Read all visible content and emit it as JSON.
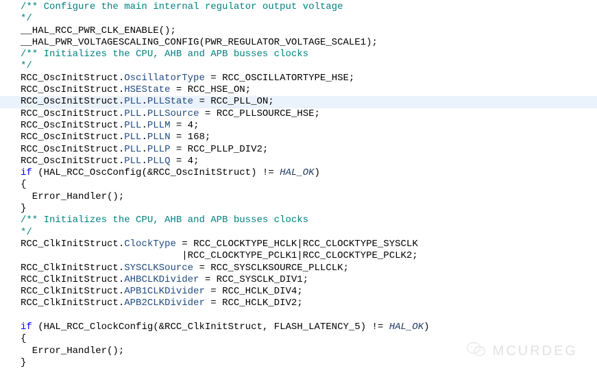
{
  "code": {
    "lines": [
      {
        "hl": false,
        "tokens": [
          {
            "cls": "c-comment",
            "t": "/** Configure the main internal regulator output voltage "
          }
        ]
      },
      {
        "hl": false,
        "tokens": [
          {
            "cls": "c-comment",
            "t": "*/"
          }
        ]
      },
      {
        "hl": false,
        "tokens": [
          {
            "cls": "c-default",
            "t": "__HAL_RCC_PWR_CLK_ENABLE();"
          }
        ]
      },
      {
        "hl": false,
        "tokens": [
          {
            "cls": "c-default",
            "t": "__HAL_PWR_VOLTAGESCALING_CONFIG(PWR_REGULATOR_VOLTAGE_SCALE1);"
          }
        ]
      },
      {
        "hl": false,
        "tokens": [
          {
            "cls": "c-comment",
            "t": "/** Initializes the CPU, AHB and APB busses clocks "
          }
        ]
      },
      {
        "hl": false,
        "tokens": [
          {
            "cls": "c-comment",
            "t": "*/"
          }
        ]
      },
      {
        "hl": false,
        "tokens": [
          {
            "cls": "c-default",
            "t": "RCC_OscInitStruct."
          },
          {
            "cls": "c-field",
            "t": "OscillatorType"
          },
          {
            "cls": "c-default",
            "t": " = RCC_OSCILLATORTYPE_HSE;"
          }
        ]
      },
      {
        "hl": false,
        "tokens": [
          {
            "cls": "c-default",
            "t": "RCC_OscInitStruct."
          },
          {
            "cls": "c-field",
            "t": "HSEState"
          },
          {
            "cls": "c-default",
            "t": " = RCC_HSE_ON;"
          }
        ]
      },
      {
        "hl": true,
        "tokens": [
          {
            "cls": "c-default",
            "t": "RCC_OscInitStruct."
          },
          {
            "cls": "c-field",
            "t": "PLL"
          },
          {
            "cls": "c-default",
            "t": "."
          },
          {
            "cls": "c-field",
            "t": "PLLState"
          },
          {
            "cls": "c-default",
            "t": " = RCC_PLL_ON;"
          }
        ]
      },
      {
        "hl": false,
        "tokens": [
          {
            "cls": "c-default",
            "t": "RCC_OscInitStruct."
          },
          {
            "cls": "c-field",
            "t": "PLL"
          },
          {
            "cls": "c-default",
            "t": "."
          },
          {
            "cls": "c-field",
            "t": "PLLSource"
          },
          {
            "cls": "c-default",
            "t": " = RCC_PLLSOURCE_HSE;"
          }
        ]
      },
      {
        "hl": false,
        "tokens": [
          {
            "cls": "c-default",
            "t": "RCC_OscInitStruct."
          },
          {
            "cls": "c-field",
            "t": "PLL"
          },
          {
            "cls": "c-default",
            "t": "."
          },
          {
            "cls": "c-field",
            "t": "PLLM"
          },
          {
            "cls": "c-default",
            "t": " = 4;"
          }
        ]
      },
      {
        "hl": false,
        "tokens": [
          {
            "cls": "c-default",
            "t": "RCC_OscInitStruct."
          },
          {
            "cls": "c-field",
            "t": "PLL"
          },
          {
            "cls": "c-default",
            "t": "."
          },
          {
            "cls": "c-field",
            "t": "PLLN"
          },
          {
            "cls": "c-default",
            "t": " = 168;"
          }
        ]
      },
      {
        "hl": false,
        "tokens": [
          {
            "cls": "c-default",
            "t": "RCC_OscInitStruct."
          },
          {
            "cls": "c-field",
            "t": "PLL"
          },
          {
            "cls": "c-default",
            "t": "."
          },
          {
            "cls": "c-field",
            "t": "PLLP"
          },
          {
            "cls": "c-default",
            "t": " = RCC_PLLP_DIV2;"
          }
        ]
      },
      {
        "hl": false,
        "tokens": [
          {
            "cls": "c-default",
            "t": "RCC_OscInitStruct."
          },
          {
            "cls": "c-field",
            "t": "PLL"
          },
          {
            "cls": "c-default",
            "t": "."
          },
          {
            "cls": "c-field",
            "t": "PLLQ"
          },
          {
            "cls": "c-default",
            "t": " = 4;"
          }
        ]
      },
      {
        "hl": false,
        "tokens": [
          {
            "cls": "c-keyword",
            "t": "if"
          },
          {
            "cls": "c-default",
            "t": " (HAL_RCC_OscConfig(&RCC_OscInitStruct) != "
          },
          {
            "cls": "c-macro",
            "t": "HAL_OK"
          },
          {
            "cls": "c-default",
            "t": ")"
          }
        ]
      },
      {
        "hl": false,
        "tokens": [
          {
            "cls": "c-default",
            "t": "{"
          }
        ]
      },
      {
        "hl": false,
        "tokens": [
          {
            "cls": "c-default",
            "t": "  Error_Handler();"
          }
        ]
      },
      {
        "hl": false,
        "tokens": [
          {
            "cls": "c-default",
            "t": "}"
          }
        ]
      },
      {
        "hl": false,
        "tokens": [
          {
            "cls": "c-comment",
            "t": "/** Initializes the CPU, AHB and APB busses clocks "
          }
        ]
      },
      {
        "hl": false,
        "tokens": [
          {
            "cls": "c-comment",
            "t": "*/"
          }
        ]
      },
      {
        "hl": false,
        "tokens": [
          {
            "cls": "c-default",
            "t": "RCC_ClkInitStruct."
          },
          {
            "cls": "c-field",
            "t": "ClockType"
          },
          {
            "cls": "c-default",
            "t": " = RCC_CLOCKTYPE_HCLK|RCC_CLOCKTYPE_SYSCLK"
          }
        ]
      },
      {
        "hl": false,
        "tokens": [
          {
            "cls": "c-default",
            "t": "                            |RCC_CLOCKTYPE_PCLK1|RCC_CLOCKTYPE_PCLK2;"
          }
        ]
      },
      {
        "hl": false,
        "tokens": [
          {
            "cls": "c-default",
            "t": "RCC_ClkInitStruct."
          },
          {
            "cls": "c-field",
            "t": "SYSCLKSource"
          },
          {
            "cls": "c-default",
            "t": " = RCC_SYSCLKSOURCE_PLLCLK;"
          }
        ]
      },
      {
        "hl": false,
        "tokens": [
          {
            "cls": "c-default",
            "t": "RCC_ClkInitStruct."
          },
          {
            "cls": "c-field",
            "t": "AHBCLKDivider"
          },
          {
            "cls": "c-default",
            "t": " = RCC_SYSCLK_DIV1;"
          }
        ]
      },
      {
        "hl": false,
        "tokens": [
          {
            "cls": "c-default",
            "t": "RCC_ClkInitStruct."
          },
          {
            "cls": "c-field",
            "t": "APB1CLKDivider"
          },
          {
            "cls": "c-default",
            "t": " = RCC_HCLK_DIV4;"
          }
        ]
      },
      {
        "hl": false,
        "tokens": [
          {
            "cls": "c-default",
            "t": "RCC_ClkInitStruct."
          },
          {
            "cls": "c-field",
            "t": "APB2CLKDivider"
          },
          {
            "cls": "c-default",
            "t": " = RCC_HCLK_DIV2;"
          }
        ]
      },
      {
        "hl": false,
        "tokens": [
          {
            "cls": "c-default",
            "t": ""
          }
        ]
      },
      {
        "hl": false,
        "tokens": [
          {
            "cls": "c-keyword",
            "t": "if"
          },
          {
            "cls": "c-default",
            "t": " (HAL_RCC_ClockConfig(&RCC_ClkInitStruct, FLASH_LATENCY_5) != "
          },
          {
            "cls": "c-macro",
            "t": "HAL_OK"
          },
          {
            "cls": "c-default",
            "t": ")"
          }
        ]
      },
      {
        "hl": false,
        "tokens": [
          {
            "cls": "c-default",
            "t": "{"
          }
        ]
      },
      {
        "hl": false,
        "tokens": [
          {
            "cls": "c-default",
            "t": "  Error_Handler();"
          }
        ]
      },
      {
        "hl": false,
        "tokens": [
          {
            "cls": "c-default",
            "t": "}"
          }
        ]
      }
    ]
  },
  "watermark": {
    "text": "MCURDEG"
  }
}
